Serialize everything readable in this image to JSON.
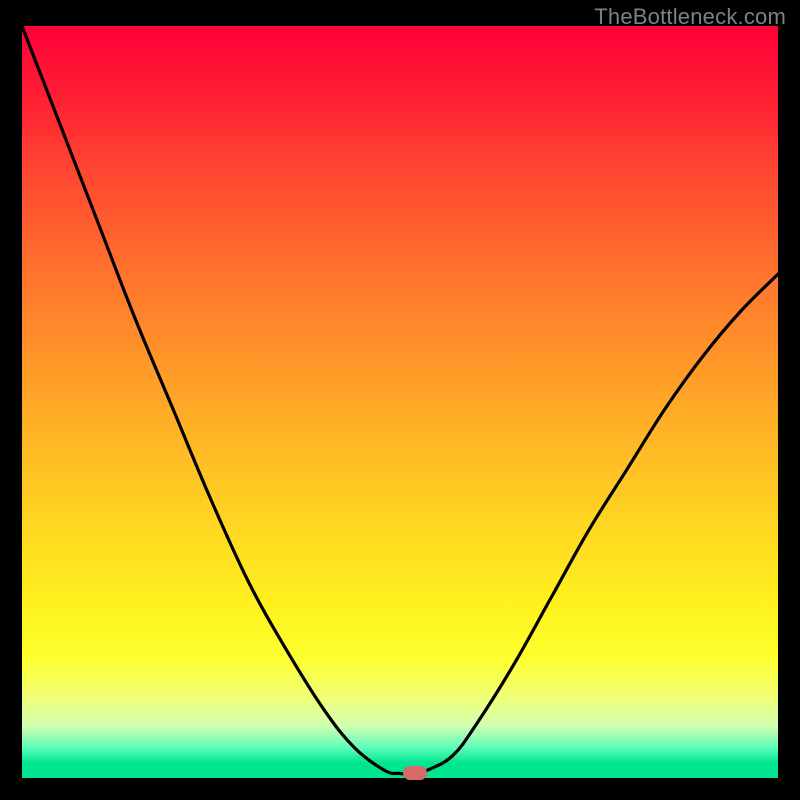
{
  "watermark": "TheBottleneck.com",
  "colors": {
    "curve_stroke": "#000000",
    "marker_fill": "#d96a6a"
  },
  "chart_data": {
    "type": "line",
    "title": "",
    "xlabel": "",
    "ylabel": "",
    "xlim": [
      0,
      1
    ],
    "ylim": [
      0,
      1
    ],
    "x_note": "normalized component rating, 0..1 across plot width",
    "y_note": "bottleneck percentage, 0 at bottom (balanced) to 1 at top",
    "series": [
      {
        "name": "bottleneck-curve",
        "x": [
          0.0,
          0.05,
          0.1,
          0.15,
          0.2,
          0.25,
          0.3,
          0.35,
          0.4,
          0.44,
          0.48,
          0.5,
          0.52,
          0.54,
          0.57,
          0.6,
          0.65,
          0.7,
          0.75,
          0.8,
          0.85,
          0.9,
          0.95,
          1.0
        ],
        "y": [
          1.0,
          0.87,
          0.74,
          0.61,
          0.49,
          0.37,
          0.26,
          0.17,
          0.09,
          0.04,
          0.01,
          0.006,
          0.006,
          0.012,
          0.03,
          0.07,
          0.15,
          0.24,
          0.33,
          0.41,
          0.49,
          0.56,
          0.62,
          0.67
        ]
      }
    ],
    "marker": {
      "x": 0.52,
      "y": 0.006
    },
    "flat_bottom": {
      "x_from": 0.48,
      "x_to": 0.54,
      "y": 0.006
    }
  }
}
